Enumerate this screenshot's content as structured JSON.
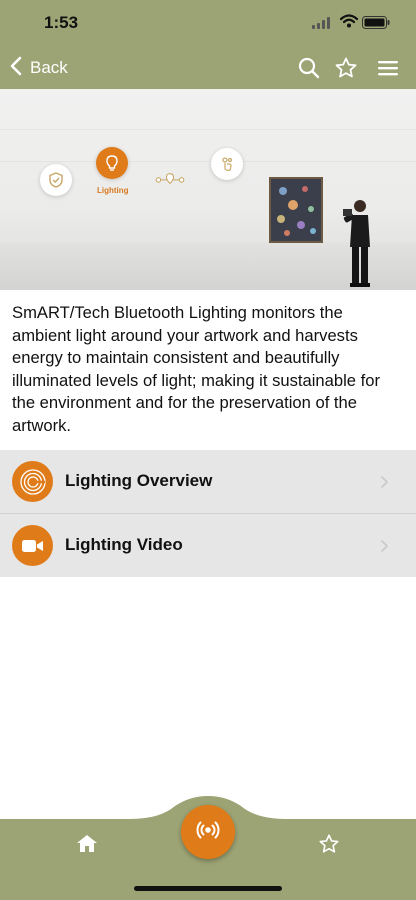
{
  "status_bar": {
    "time": "1:53"
  },
  "nav": {
    "back_label": "Back",
    "icons": [
      "search-icon",
      "star-icon",
      "menu-icon"
    ]
  },
  "hero": {
    "label": "Lighting",
    "icons": [
      "shield-icon",
      "bulb-icon",
      "location-icon",
      "touch-icon"
    ]
  },
  "content": {
    "description": "SmART/Tech Bluetooth Lighting monitors the ambient light around your artwork and harvests energy to maintain consistent and beautifully illuminated levels of light; making it sustainable for the environment and for the preservation of the artwork."
  },
  "list": {
    "items": [
      {
        "label": "Lighting Overview",
        "icon": "spiral-icon"
      },
      {
        "label": "Lighting Video",
        "icon": "video-camera-icon"
      }
    ]
  },
  "tab_bar": {
    "items": [
      "home-icon",
      "broadcast-icon",
      "star-icon"
    ]
  },
  "colors": {
    "bar": "#9ca374",
    "accent": "#e07b1a",
    "list_bg": "#e6e6e6"
  }
}
